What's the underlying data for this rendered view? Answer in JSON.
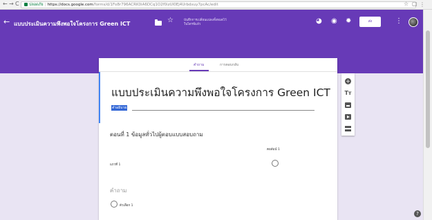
{
  "browser": {
    "back": "←",
    "forward": "→",
    "reload": "C",
    "secure_label": "ปลอดภัย",
    "url_host": "https://docs.google.com",
    "url_path": "/forms/d/1Fo8r796ACRK0iA6DCq1O2f0izUI0Ej4Urbdxuy7pcAc/edit",
    "star_glyph": "☆",
    "ext_glyph": "▢",
    "menu_glyph": "⋮"
  },
  "header": {
    "back_glyph": "←",
    "title": "แบบประเมินความพึงพอใจโครงการ Green ICT",
    "star_glyph": "☆",
    "saved_line1": "บันทึกการเปลี่ยนแปลงทั้งหมดไว้",
    "saved_line2": "ในไดรฟ์แล้ว",
    "palette_glyph": "◕",
    "eye_glyph": "◉",
    "gear_glyph": "✹",
    "send_label": "ส่ง",
    "more_glyph": "⋮",
    "brand_color": "#673ab7"
  },
  "tabs": [
    {
      "label": "คำถาม"
    },
    {
      "label": "การตอบกลับ"
    }
  ],
  "form": {
    "title": "แบบประเมินความพึงพอใจโครงการ Green  ICT",
    "description_label": "คำอธิบาย",
    "section_title": "ตอนที่ 1 ข้อมูลทั่วไปผู้ตอบแบบสอบถาม",
    "column_header": "คอลัมน์ 1",
    "row_label": "แถวที่ 1",
    "question_placeholder": "คำถาม",
    "option_label": "ตัวเลือก 1"
  },
  "toolbar": {
    "plus_glyph": "+",
    "text_glyph": "Tт"
  },
  "help_glyph": "?"
}
